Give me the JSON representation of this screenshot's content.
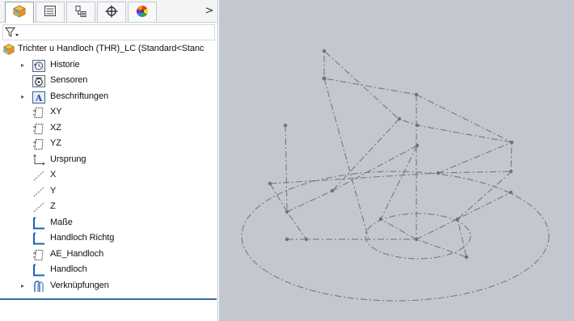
{
  "tabs": [
    {
      "name": "feature-manager",
      "icon": "part-cube-icon",
      "active": true
    },
    {
      "name": "property-manager",
      "icon": "property-list-icon",
      "active": false
    },
    {
      "name": "configuration-manager",
      "icon": "configuration-icon",
      "active": false
    },
    {
      "name": "dimxpert-manager",
      "icon": "crosshair-icon",
      "active": false
    },
    {
      "name": "display-manager",
      "icon": "color-wheel-icon",
      "active": false
    }
  ],
  "tabs_more_glyph": ">",
  "filter": {
    "icon": "funnel-filter-icon"
  },
  "tree": {
    "root_label": "Trichter u Handloch (THR)_LC  (Standard<Stanc",
    "items": [
      {
        "label": "Historie",
        "icon": "history-icon",
        "expandable": true
      },
      {
        "label": "Sensoren",
        "icon": "sensor-icon",
        "expandable": false
      },
      {
        "label": "Beschriftungen",
        "icon": "annotations-icon",
        "expandable": true
      },
      {
        "label": "XY",
        "icon": "plane-icon",
        "expandable": false
      },
      {
        "label": "XZ",
        "icon": "plane-icon",
        "expandable": false
      },
      {
        "label": "YZ",
        "icon": "plane-icon",
        "expandable": false
      },
      {
        "label": "Ursprung",
        "icon": "origin-icon",
        "expandable": false
      },
      {
        "label": "X",
        "icon": "axis-icon",
        "expandable": false
      },
      {
        "label": "Y",
        "icon": "axis-icon",
        "expandable": false
      },
      {
        "label": "Z",
        "icon": "axis-icon",
        "expandable": false
      },
      {
        "label": "Maße",
        "icon": "sketch-icon",
        "expandable": false
      },
      {
        "label": "Handloch Richtg",
        "icon": "sketch-icon",
        "expandable": false
      },
      {
        "label": "AE_Handloch",
        "icon": "plane-icon",
        "expandable": false
      },
      {
        "label": "Handloch",
        "icon": "sketch-icon",
        "expandable": false
      },
      {
        "label": "Verknüpfungen",
        "icon": "mates-icon",
        "expandable": true
      }
    ]
  },
  "colors": {
    "viewport_bg": "#c3c7cf",
    "sketch_line": "#6f7278",
    "accent_blue": "#3a6ea5"
  }
}
